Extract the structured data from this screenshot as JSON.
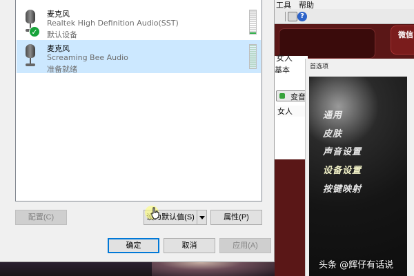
{
  "background_app": {
    "menu": {
      "tools": "工具",
      "help": "帮助"
    },
    "red_tab_label": "微信",
    "people_label": "女人",
    "basic_label": "基本",
    "voice_change_label": "变音",
    "woman_label": "女人",
    "preferences": {
      "title": "首选项",
      "items": [
        {
          "label": "通用"
        },
        {
          "label": "皮肤"
        },
        {
          "label": "声音设置"
        },
        {
          "label": "设备设置",
          "selected": true
        },
        {
          "label": "按键映射"
        }
      ]
    }
  },
  "dialog": {
    "devices": [
      {
        "name": "麦克风",
        "description": "Realtek High Definition Audio(SST)",
        "status": "默认设备",
        "is_default": true,
        "selected": false,
        "level": 0.05
      },
      {
        "name": "麦克风",
        "description": "Screaming Bee Audio",
        "status": "准备就绪",
        "is_default": false,
        "selected": true,
        "level": 0.0
      }
    ],
    "buttons": {
      "configure": "配置(C)",
      "set_default": "设为默认值(S)",
      "properties": "属性(P)",
      "ok": "确定",
      "cancel": "取消",
      "apply": "应用(A)"
    }
  },
  "watermark": "头条 @辉仔有话说",
  "colors": {
    "selection": "#cce8ff",
    "check_green": "#17a33a",
    "focus_border": "#0078d7"
  }
}
